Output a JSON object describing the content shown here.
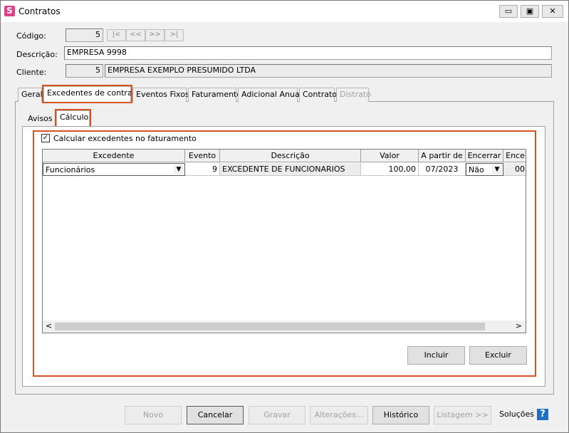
{
  "window": {
    "title": "Contratos",
    "app_icon": "S",
    "controls": {
      "minimize": "▭",
      "maximize": "▣",
      "close": "✕"
    }
  },
  "form": {
    "codigo_label": "Código:",
    "codigo_value": "5",
    "nav": {
      "first": "|<",
      "prev": "<<",
      "next": ">>",
      "last": ">|"
    },
    "descricao_label": "Descrição:",
    "descricao_value": "EMPRESA 9998",
    "cliente_label": "Cliente:",
    "cliente_code": "5",
    "cliente_name": "EMPRESA EXEMPLO PRESUMIDO LTDA"
  },
  "tabs": [
    {
      "label": "Geral"
    },
    {
      "label": "Excedentes de contrato"
    },
    {
      "label": "Eventos Fixos"
    },
    {
      "label": "Faturamento"
    },
    {
      "label": "Adicional Anual"
    },
    {
      "label": "Contrato"
    },
    {
      "label": "Distrato"
    }
  ],
  "subtabs": [
    {
      "label": "Avisos"
    },
    {
      "label": "Cálculo"
    }
  ],
  "calculo": {
    "checkbox_label": "Calcular excedentes no faturamento",
    "checkbox_checked": true,
    "checkbox_mark": "✓",
    "columns": [
      "Excedente",
      "Evento",
      "Descrição",
      "Valor",
      "A partir de",
      "Encerrar",
      "Ence"
    ],
    "rows": [
      {
        "excedente": "Funcionários",
        "evento": "9",
        "descricao": "EXCEDENTE DE FUNCIONARIOS",
        "valor": "100,00",
        "a_partir_de": "07/2023",
        "encerrar": "Não",
        "ence": "00"
      }
    ],
    "scroll_left": "<",
    "scroll_right": ">",
    "incluir_label": "Incluir",
    "excluir_label": "Excluir"
  },
  "footer": {
    "novo": "Novo",
    "cancelar": "Cancelar",
    "gravar": "Gravar",
    "alteracoes": "Alterações...",
    "historico": "Histórico",
    "listagem": "Listagem >>",
    "solucoes": "Soluções",
    "help": "?"
  },
  "colors": {
    "highlight": "#d6531f",
    "help_icon": "#1e6fc5",
    "app_icon": "#e0408a"
  }
}
